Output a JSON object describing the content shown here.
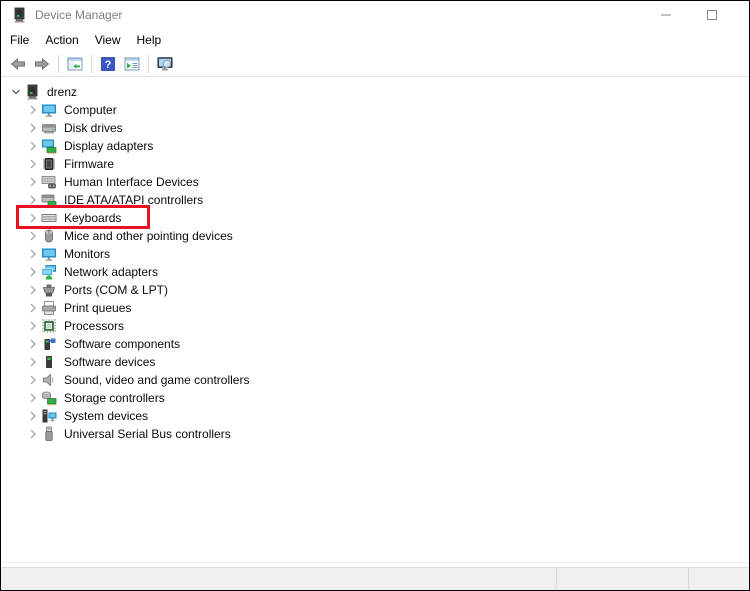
{
  "window": {
    "title": "Device Manager",
    "app_icon": "device-manager",
    "controls": [
      {
        "name": "minimize",
        "icon": "minimize"
      },
      {
        "name": "maximize",
        "icon": "maximize"
      }
    ]
  },
  "menu": {
    "items": [
      {
        "label": "File"
      },
      {
        "label": "Action"
      },
      {
        "label": "View"
      },
      {
        "label": "Help"
      }
    ]
  },
  "toolbar": {
    "buttons": [
      {
        "name": "back",
        "icon": "back-arrow",
        "sep_after": false
      },
      {
        "name": "forward",
        "icon": "forward-arrow",
        "sep_after": true
      },
      {
        "name": "show-console-tree",
        "icon": "console-tree-window",
        "sep_after": true
      },
      {
        "name": "help",
        "icon": "help",
        "sep_after": false
      },
      {
        "name": "show-action-pane",
        "icon": "action-pane-window",
        "sep_after": true
      },
      {
        "name": "scan-for-hardware-changes",
        "icon": "scan-monitor",
        "sep_after": false
      }
    ]
  },
  "tree": {
    "root": {
      "label": "drenz",
      "icon": "device-manager",
      "expanded": true
    },
    "items": [
      {
        "label": "Computer",
        "icon": "computer",
        "expanded": false
      },
      {
        "label": "Disk drives",
        "icon": "disk-drive",
        "expanded": false
      },
      {
        "label": "Display adapters",
        "icon": "display-adapter",
        "expanded": false
      },
      {
        "label": "Firmware",
        "icon": "firmware-chip",
        "expanded": false
      },
      {
        "label": "Human Interface Devices",
        "icon": "hid-device",
        "expanded": false
      },
      {
        "label": "IDE ATA/ATAPI controllers",
        "icon": "ide-controller",
        "expanded": false
      },
      {
        "label": "Keyboards",
        "icon": "keyboard",
        "expanded": false,
        "highlighted": true
      },
      {
        "label": "Mice and other pointing devices",
        "icon": "mouse",
        "expanded": false
      },
      {
        "label": "Monitors",
        "icon": "monitor",
        "expanded": false
      },
      {
        "label": "Network adapters",
        "icon": "network-adapter",
        "expanded": false
      },
      {
        "label": "Ports (COM & LPT)",
        "icon": "serial-port",
        "expanded": false
      },
      {
        "label": "Print queues",
        "icon": "printer",
        "expanded": false
      },
      {
        "label": "Processors",
        "icon": "processor-chip",
        "expanded": false
      },
      {
        "label": "Software components",
        "icon": "software-component",
        "expanded": false
      },
      {
        "label": "Software devices",
        "icon": "software-device",
        "expanded": false
      },
      {
        "label": "Sound, video and game controllers",
        "icon": "speaker",
        "expanded": false
      },
      {
        "label": "Storage controllers",
        "icon": "storage-controller",
        "expanded": false
      },
      {
        "label": "System devices",
        "icon": "system-device",
        "expanded": false
      },
      {
        "label": "Universal Serial Bus controllers",
        "icon": "usb-plug",
        "expanded": false
      }
    ]
  },
  "annotation": {
    "target": "Keyboards",
    "color": "#e81123"
  },
  "statusbar": {
    "left": "",
    "middle": "",
    "right": ""
  },
  "colors": {
    "title_text": "#7e7e7e",
    "tree_text": "#0a0a0a",
    "icon_blue": "#1e8bc3",
    "icon_green": "#2fae43",
    "statusbar_bg": "#f0f0f0",
    "annotation_red": "#e81123"
  }
}
